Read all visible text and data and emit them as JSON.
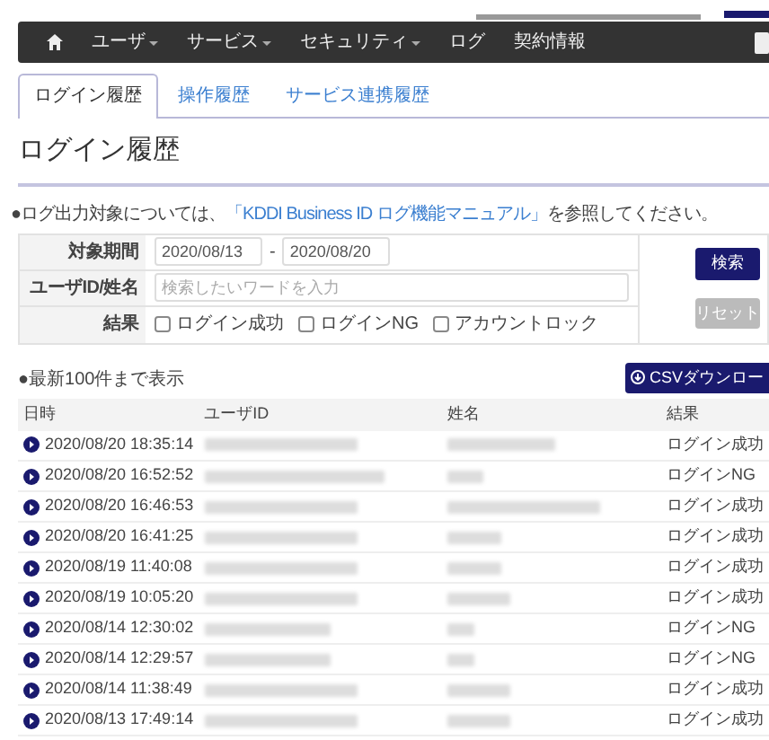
{
  "navbar": {
    "items": [
      {
        "label": "ユーザ",
        "dropdown": true
      },
      {
        "label": "サービス",
        "dropdown": true
      },
      {
        "label": "セキュリティ",
        "dropdown": true
      },
      {
        "label": "ログ",
        "dropdown": false
      },
      {
        "label": "契約情報",
        "dropdown": false
      }
    ]
  },
  "tabs": [
    {
      "label": "ログイン履歴",
      "selected": true
    },
    {
      "label": "操作履歴",
      "selected": false
    },
    {
      "label": "サービス連携履歴",
      "selected": false
    }
  ],
  "heading": "ログイン履歴",
  "note": {
    "before": "●ログ出力対象については、",
    "link": "「KDDI Business ID ログ機能マニュアル」",
    "after": "を参照してください。"
  },
  "form": {
    "period_label": "対象期間",
    "date_from": "2020/08/13",
    "separator": "-",
    "date_to": "2020/08/20",
    "keyword_label": "ユーザID/姓名",
    "keyword_placeholder": "検索したいワードを入力",
    "result_label": "結果",
    "checkboxes": [
      {
        "label": "ログイン成功",
        "checked": false
      },
      {
        "label": "ログインNG",
        "checked": false
      },
      {
        "label": "アカウントロック",
        "checked": false
      }
    ],
    "buttons": [
      {
        "label": "検索",
        "disabled": false
      },
      {
        "label": "リセット",
        "disabled": true
      }
    ]
  },
  "csv_button": "CSVダウンロー",
  "limit_note": "●最新100件まで表示",
  "table": {
    "columns": [
      "日時",
      "ユーザID",
      "姓名",
      "結果"
    ],
    "rows": [
      {
        "datetime": "2020/08/20 18:35:14",
        "result": "ログイン成功"
      },
      {
        "datetime": "2020/08/20 16:52:52",
        "result": "ログインNG"
      },
      {
        "datetime": "2020/08/20 16:46:53",
        "result": "ログイン成功"
      },
      {
        "datetime": "2020/08/20 16:41:25",
        "result": "ログイン成功"
      },
      {
        "datetime": "2020/08/19 11:40:08",
        "result": "ログイン成功"
      },
      {
        "datetime": "2020/08/19 10:05:20",
        "result": "ログイン成功"
      },
      {
        "datetime": "2020/08/14 12:30:02",
        "result": "ログインNG"
      },
      {
        "datetime": "2020/08/14 12:29:57",
        "result": "ログインNG"
      },
      {
        "datetime": "2020/08/14 11:38:49",
        "result": "ログイン成功"
      },
      {
        "datetime": "2020/08/13 17:49:14",
        "result": "ログイン成功"
      }
    ]
  }
}
